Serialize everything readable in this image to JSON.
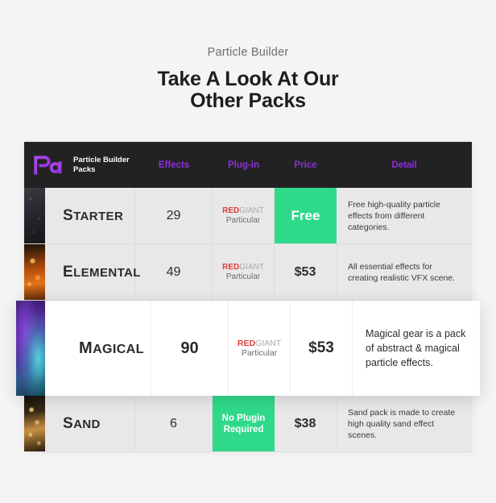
{
  "header": {
    "eyebrow": "Particle Builder",
    "headline_line1": "Take A Look At Our",
    "headline_line2": "Other Packs"
  },
  "table": {
    "logo": {
      "mark": "pa-logo-icon",
      "title_line1": "Particle Builder",
      "title_line2": "Packs"
    },
    "columns": [
      {
        "key": "name",
        "label": ""
      },
      {
        "key": "effects",
        "label": "Effects"
      },
      {
        "key": "plugin",
        "label": "Plug-in"
      },
      {
        "key": "price",
        "label": "Price"
      },
      {
        "key": "detail",
        "label": "Detail"
      }
    ],
    "plugin_brand": {
      "red": "RED",
      "giant": "GIANT",
      "product": "Particular"
    },
    "rows": [
      {
        "thumb": "starter-thumbnail",
        "name_initial": "S",
        "name_rest": "TARTER",
        "effects": "29",
        "plugin_type": "redgiant",
        "plugin_text": "",
        "price": "Free",
        "price_highlight": true,
        "plugin_highlight": false,
        "detail": "Free high-quality particle effects from different categories.",
        "featured": false
      },
      {
        "thumb": "elemental-thumbnail",
        "name_initial": "E",
        "name_rest": "LEMENTAL",
        "effects": "49",
        "plugin_type": "redgiant",
        "plugin_text": "",
        "price": "$53",
        "price_highlight": false,
        "plugin_highlight": false,
        "detail": "All essential effects for creating realistic VFX scene.",
        "featured": false
      },
      {
        "thumb": "magical-thumbnail",
        "name_initial": "M",
        "name_rest": "AGICAL",
        "effects": "90",
        "plugin_type": "redgiant",
        "plugin_text": "",
        "price": "$53",
        "price_highlight": false,
        "plugin_highlight": false,
        "detail": "Magical gear is a pack of abstract & magical particle effects.",
        "featured": true
      },
      {
        "thumb": "sand-thumbnail",
        "name_initial": "S",
        "name_rest": "AND",
        "effects": "6",
        "plugin_type": "text",
        "plugin_text": "No Plugin Required",
        "price": "$38",
        "price_highlight": false,
        "plugin_highlight": true,
        "detail": "Sand pack is made to create high quality sand effect scenes.",
        "featured": false
      }
    ]
  },
  "colors": {
    "page_bg": "#f4f4f4",
    "header_bg": "#232223",
    "row_bg": "#e9e8e9",
    "featured_bg": "#ffffff",
    "accent_purple": "#8b2fe0",
    "accent_green": "#2fd98a",
    "brand_red": "#e03c3c"
  }
}
